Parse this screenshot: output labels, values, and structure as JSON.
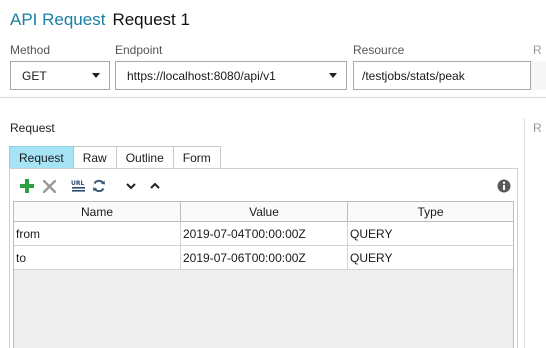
{
  "header": {
    "app_title": "API Request",
    "request_title": "Request 1"
  },
  "fields": {
    "method_label": "Method",
    "method_value": "GET",
    "endpoint_label": "Endpoint",
    "endpoint_value": "https://localhost:8080/api/v1",
    "resource_label": "Resource",
    "resource_value": "/testjobs/stats/peak"
  },
  "request_section": {
    "label": "Request",
    "tabs": [
      {
        "label": "Request",
        "active": true
      },
      {
        "label": "Raw",
        "active": false
      },
      {
        "label": "Outline",
        "active": false
      },
      {
        "label": "Form",
        "active": false
      }
    ]
  },
  "toolbar": {
    "icons": [
      "add-icon",
      "delete-icon",
      "url-encode-icon",
      "refresh-icon",
      "move-down-icon",
      "move-up-icon",
      "info-icon"
    ],
    "colors": {
      "add": "#2ea043",
      "delete": "#9a9a9a",
      "refresh": "#3b5b7a",
      "info": "#5a5a5a",
      "tab_active": "#a6e3f4",
      "title_accent": "#1a7fa3"
    }
  },
  "params_table": {
    "columns": [
      "Name",
      "Value",
      "Type"
    ],
    "rows": [
      {
        "name": "from",
        "value": "2019-07-04T00:00:00Z",
        "type": "QUERY"
      },
      {
        "name": "to",
        "value": "2019-07-06T00:00:00Z",
        "type": "QUERY"
      }
    ]
  }
}
